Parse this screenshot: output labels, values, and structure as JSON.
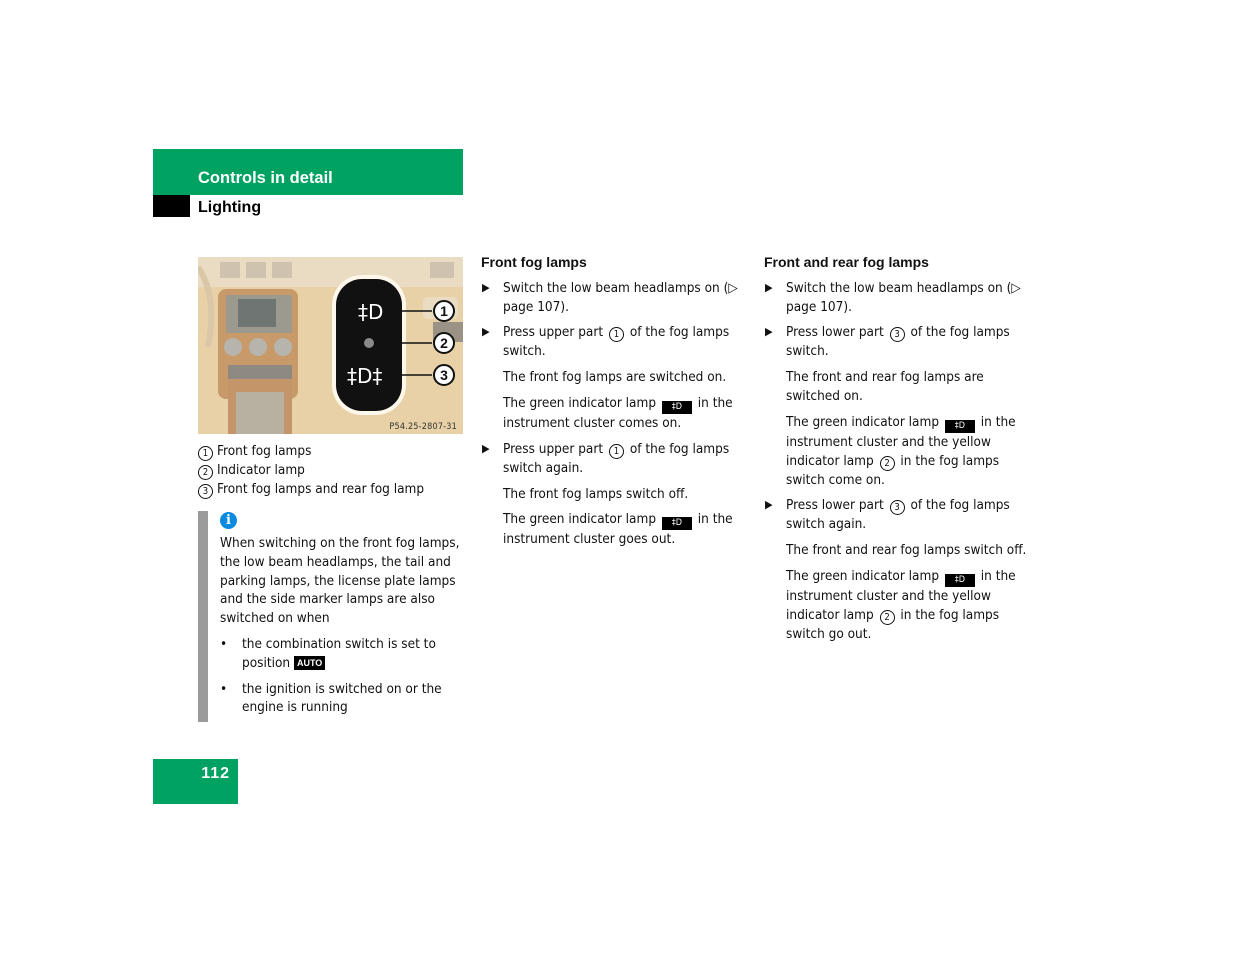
{
  "header": {
    "section": "Controls in detail",
    "subsection": "Lighting",
    "accent_color": "#00a262"
  },
  "figure": {
    "code": "P54.25-2807-31",
    "callouts": [
      "1",
      "2",
      "3"
    ],
    "switch_upper_symbol": "front-fog-lamp-symbol",
    "switch_lower_symbol": "front-and-rear-fog-lamp-symbol"
  },
  "legend": [
    {
      "num": "1",
      "label": "Front fog lamps"
    },
    {
      "num": "2",
      "label": "Indicator lamp"
    },
    {
      "num": "3",
      "label": "Front fog lamps and rear fog lamp"
    }
  ],
  "note": {
    "icon": "info-icon",
    "intro": "When switching on the front fog lamps, the low beam headlamps, the tail and parking lamps, the license plate lamps and the side marker lamps are also switched on when",
    "bullet1_pre": "the combination switch is set to position",
    "bullet1_badge": "AUTO",
    "bullet2": "the ignition is switched on or the engine is running"
  },
  "front": {
    "heading": "Front fog lamps",
    "s1_pre": "Switch the low beam headlamps on (",
    "s1_ref": "▷ page 107",
    "s1_post": ").",
    "s2_pre": "Press upper part",
    "s2_num": "1",
    "s2_post": "of the fog lamps switch.",
    "r1": "The front fog lamps are switched on.",
    "r2_pre": "The green indicator lamp",
    "r2_post": "in the instrument cluster comes on.",
    "s3_pre": "Press upper part",
    "s3_num": "1",
    "s3_post": "of the fog lamps switch again.",
    "r3": "The front fog lamps switch off.",
    "r4_pre": "The green indicator lamp",
    "r4_post": "in the instrument cluster goes out."
  },
  "rear": {
    "heading": "Front and rear fog lamps",
    "s1_pre": "Switch the low beam headlamps on (",
    "s1_ref": "▷ page 107",
    "s1_post": ").",
    "s2_pre": "Press lower part",
    "s2_num": "3",
    "s2_post": "of the fog lamps switch.",
    "r1": "The front and rear fog lamps are switched on.",
    "r2_pre": "The green indicator lamp",
    "r2_mid": "in the instrument cluster and the yellow indicator lamp",
    "r2_num": "2",
    "r2_post": "in the fog lamps switch come on.",
    "s3_pre": "Press lower part",
    "s3_num": "3",
    "s3_post": "of the fog lamps switch again.",
    "r3": "The front and rear fog lamps switch off.",
    "r4_pre": "The green indicator lamp",
    "r4_mid": "in the instrument cluster and the yellow indicator lamp",
    "r4_num": "2",
    "r4_post": "in the fog lamps switch go out."
  },
  "lamp_symbol": "‡D",
  "page_number": "112"
}
